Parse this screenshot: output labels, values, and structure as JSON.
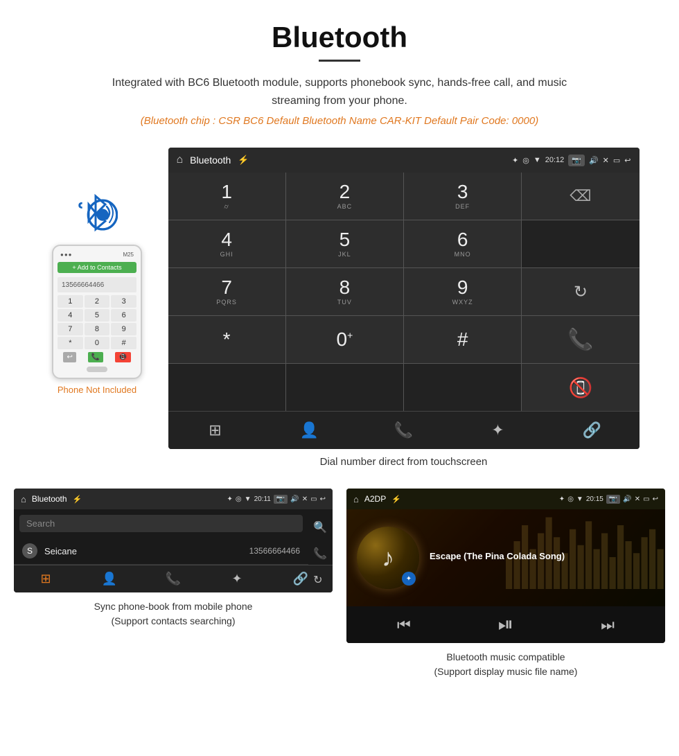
{
  "header": {
    "title": "Bluetooth",
    "description": "Integrated with BC6 Bluetooth module, supports phonebook sync, hands-free call, and music streaming from your phone.",
    "specs": "(Bluetooth chip : CSR BC6    Default Bluetooth Name CAR-KIT    Default Pair Code: 0000)"
  },
  "car_screen": {
    "status_bar": {
      "title": "Bluetooth",
      "time": "20:12",
      "icons": [
        "⌂",
        "✦",
        "⌨"
      ]
    },
    "dialpad": {
      "keys": [
        {
          "num": "1",
          "sub": "⌭"
        },
        {
          "num": "2",
          "sub": "ABC"
        },
        {
          "num": "3",
          "sub": "DEF"
        },
        {
          "num": "4",
          "sub": "GHI"
        },
        {
          "num": "5",
          "sub": "JKL"
        },
        {
          "num": "6",
          "sub": "MNO"
        },
        {
          "num": "7",
          "sub": "PQRS"
        },
        {
          "num": "8",
          "sub": "TUV"
        },
        {
          "num": "9",
          "sub": "WXYZ"
        },
        {
          "num": "*",
          "sub": ""
        },
        {
          "num": "0",
          "sub": "+"
        },
        {
          "num": "#",
          "sub": ""
        }
      ]
    },
    "caption": "Dial number direct from touchscreen"
  },
  "phonebook_screen": {
    "status_bar": {
      "title": "Bluetooth",
      "time": "20:11"
    },
    "search_placeholder": "Search",
    "contacts": [
      {
        "letter": "S",
        "name": "Seicane",
        "number": "13566664466"
      }
    ],
    "caption_line1": "Sync phone-book from mobile phone",
    "caption_line2": "(Support contacts searching)"
  },
  "music_screen": {
    "status_bar": {
      "title": "A2DP",
      "time": "20:15"
    },
    "song_title": "Escape (The Pina Colada Song)",
    "caption_line1": "Bluetooth music compatible",
    "caption_line2": "(Support display music file name)"
  },
  "phone_aside": {
    "not_included_text": "Phone Not Included"
  },
  "nav_icons": {
    "grid": "⊞",
    "person": "👤",
    "phone": "📞",
    "bluetooth": "✦",
    "link": "🔗"
  }
}
